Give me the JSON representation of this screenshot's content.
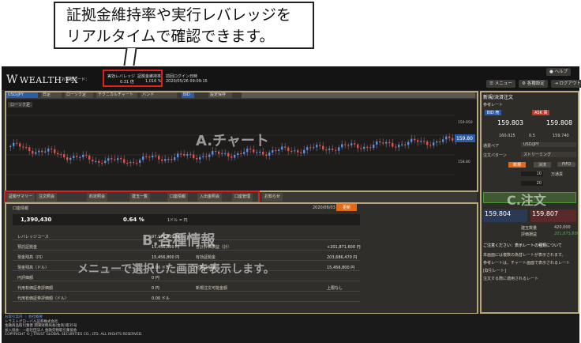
{
  "callout": {
    "line1": "証拠金維持率や実行レバレッジを",
    "line2": "リアルタイムで確認できます。"
  },
  "header": {
    "logo_text": "WEALTH FX",
    "account_label": "お客様コード：",
    "leverage_label": "実効レバレッジ",
    "leverage_value": "0.31 倍",
    "margin_label": "証拠金維持率",
    "margin_value": "1,016 %",
    "last_login_label": "前回ログイン日時",
    "last_login_value": "2020/05/26 09:09:15",
    "help": "ヘルプ",
    "menu": "メニュー",
    "settings": "各種設定",
    "logout": "ログアウト"
  },
  "toolbar": {
    "pair": "USD/JPY",
    "period": "日足",
    "candle": "ローソク足",
    "tech": "テクニカルチャート",
    "band": "バンド",
    "bid": "BID",
    "save": "設定保存"
  },
  "chart": {
    "legend": "ローソク足",
    "overlay": "A.チャート",
    "price_hi": "159.950",
    "price_lo": "158.80",
    "price_tag": "159.80"
  },
  "tabs": [
    "証拠サマリー",
    "注文照会",
    "約定照会",
    "建玉一覧",
    "口座情報",
    "入出金照会",
    "口座管理",
    "お知らせ"
  ],
  "info": {
    "overlay_title": "B.各種情報",
    "overlay_text": "メニューで選択した画面を表示します。",
    "account": "口座情報",
    "timestamp": "2020/06/03 15:54:15",
    "refresh": "更新",
    "col1": "1,390,430",
    "col2": "0.64 %",
    "col3": "1ドル = 円",
    "rows": [
      {
        "label": "レバレッジコース",
        "value": "97,171,600 円"
      },
      {
        "label": "預託証拠金",
        "value": "15,456,800 円",
        "label2": "合計評価損益（計）",
        "value2": "+201,871,600 円"
      },
      {
        "label": "現金残高（円）",
        "value": "15,456,800 円",
        "label2": "有効証拠金",
        "value2": "203,686,470 円"
      },
      {
        "label": "現金残高（ドル）",
        "value": "0.00 ドル",
        "label2": "必要証拠金",
        "value2": "15,456,800 円"
      },
      {
        "label": "円評価額",
        "value": "0 円",
        "label2": "",
        "value2": ""
      },
      {
        "label": "代用有価証券評価額",
        "value": "0 円",
        "label2": "新規注文可能金額",
        "value2": "上限なし"
      },
      {
        "label": "代用有価証券評価額（ドル）",
        "value": "0.00 ドル",
        "label2": "",
        "value2": ""
      }
    ]
  },
  "order": {
    "title": "新規/決済注文",
    "sub": "参考レート",
    "bid_label": "BID 売",
    "ask_label": "ASK 買",
    "bid_price": "159.803",
    "ask_price": "159.808",
    "spread_lo": "160.025",
    "spread_mid": "0.5",
    "spread_hi": "159.740",
    "pair_label": "通貨ペア",
    "pair_value": "USD/JPY",
    "type_label": "注文パターン",
    "type_value": "ストリーミング",
    "side_new": "新規",
    "side_close": "決済",
    "side_fifo": "FIFO",
    "qty": "10",
    "qty_unit": "万通貨",
    "slip": "20",
    "overlay": "C.注文",
    "bid2": "159.804",
    "ask2": "159.807",
    "pos_label": "建玉数量",
    "pos_value": "420,000",
    "pnl_label": "評価損益",
    "pnl_value": "201,873,600",
    "note1": "ご注意ください：表示レートの種類について",
    "note2": "本画面には複数の為替レートが表示されます。",
    "note3": "参考レートは、チャート画面で表示されるレート",
    "note4": "[取引レート]",
    "note5": "注文する際に適用されるレート"
  },
  "footer": {
    "l1": "お取引案内 ｜ 会社概要",
    "l2": "トラストグローバル証券株式会社",
    "l3": "金融商品取引業者 関東財務局長(金商)第35号",
    "l4": "加入協会：一般社団法人 金融先物取引業協会",
    "l5": "COPYRIGHT © J TRUST GLOBAL SECURITIES CO., LTD. ALL RIGHTS RESERVED."
  }
}
